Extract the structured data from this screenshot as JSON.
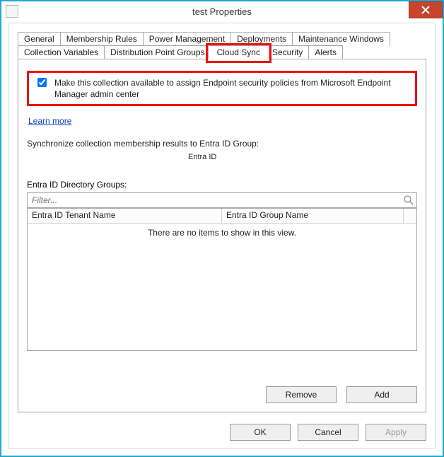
{
  "window": {
    "title": "test Properties"
  },
  "tabs": {
    "row1": [
      "General",
      "Membership Rules",
      "Power Management",
      "Deployments",
      "Maintenance Windows"
    ],
    "row2": [
      "Collection Variables",
      "Distribution Point Groups",
      "Cloud Sync",
      "Security",
      "Alerts"
    ],
    "active": "Cloud Sync"
  },
  "cloud_sync": {
    "checkbox_checked": true,
    "checkbox_label": "Make this collection available to assign Endpoint security policies from Microsoft Endpoint Manager admin center",
    "learn_more": "Learn more",
    "sync_label": "Synchronize collection membership results to  Entra ID Group:",
    "entra_id_small": "Entra ID",
    "groups_label": "Entra ID Directory Groups:",
    "filter_placeholder": "Filter...",
    "table": {
      "col1": "Entra ID  Tenant  Name",
      "col2": "Entra ID  Group  Name",
      "empty": "There are no items to show in this view."
    },
    "buttons": {
      "remove": "Remove",
      "add": "Add"
    }
  },
  "footer": {
    "ok": "OK",
    "cancel": "Cancel",
    "apply": "Apply"
  }
}
